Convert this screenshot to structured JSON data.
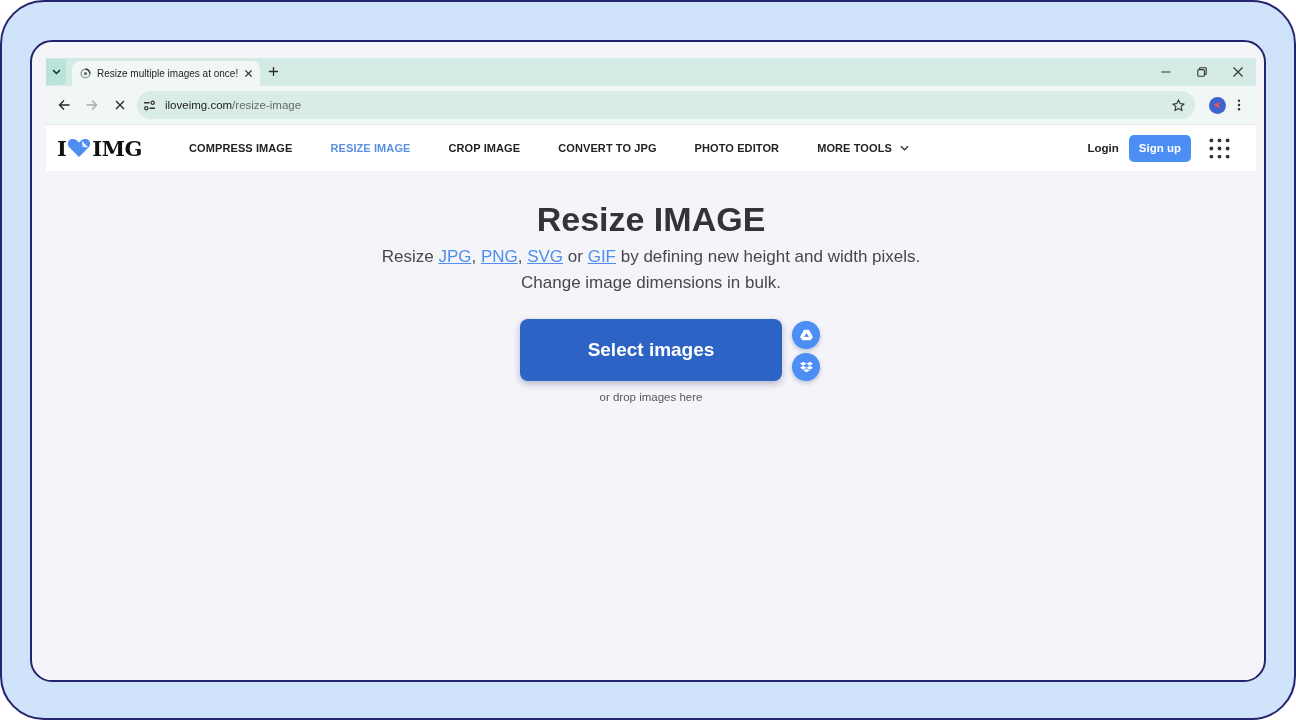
{
  "browser": {
    "tabs": [
      {
        "title": "Resize multiple images at once!",
        "selected": true
      }
    ],
    "nav_buttons": [
      {
        "kind": "back",
        "disabled": false
      },
      {
        "kind": "forward",
        "disabled": true
      },
      {
        "kind": "stop",
        "disabled": false
      }
    ],
    "address": {
      "host": "iloveimg.com",
      "path": "/resize-image"
    }
  },
  "site": {
    "logo": {
      "left": "I",
      "right": "IMG"
    },
    "nav": [
      {
        "label": "COMPRESS IMAGE",
        "kind": "link",
        "selected": false
      },
      {
        "label": "RESIZE IMAGE",
        "kind": "link",
        "selected": true
      },
      {
        "label": "CROP IMAGE",
        "kind": "link",
        "selected": false
      },
      {
        "label": "CONVERT TO JPG",
        "kind": "link",
        "selected": false
      },
      {
        "label": "PHOTO EDITOR",
        "kind": "link",
        "selected": false
      },
      {
        "label": "MORE TOOLS",
        "kind": "dropdown",
        "selected": false
      }
    ],
    "login": "Login",
    "signup": "Sign up"
  },
  "hero": {
    "title": "Resize IMAGE",
    "subtitle": {
      "parts": [
        {
          "kind": "text",
          "text": "Resize "
        },
        {
          "kind": "link",
          "text": "JPG"
        },
        {
          "kind": "text",
          "text": ", "
        },
        {
          "kind": "link",
          "text": "PNG"
        },
        {
          "kind": "text",
          "text": ", "
        },
        {
          "kind": "link",
          "text": "SVG"
        },
        {
          "kind": "text",
          "text": " or "
        },
        {
          "kind": "link",
          "text": "GIF"
        },
        {
          "kind": "text",
          "text": " by defining new height and width pixels."
        }
      ],
      "second_line": "Change image dimensions in bulk."
    },
    "select_button": "Select images",
    "cloud_buttons": [
      {
        "kind": "drive"
      },
      {
        "kind": "dropbox"
      }
    ],
    "drop_hint": "or drop images here"
  }
}
